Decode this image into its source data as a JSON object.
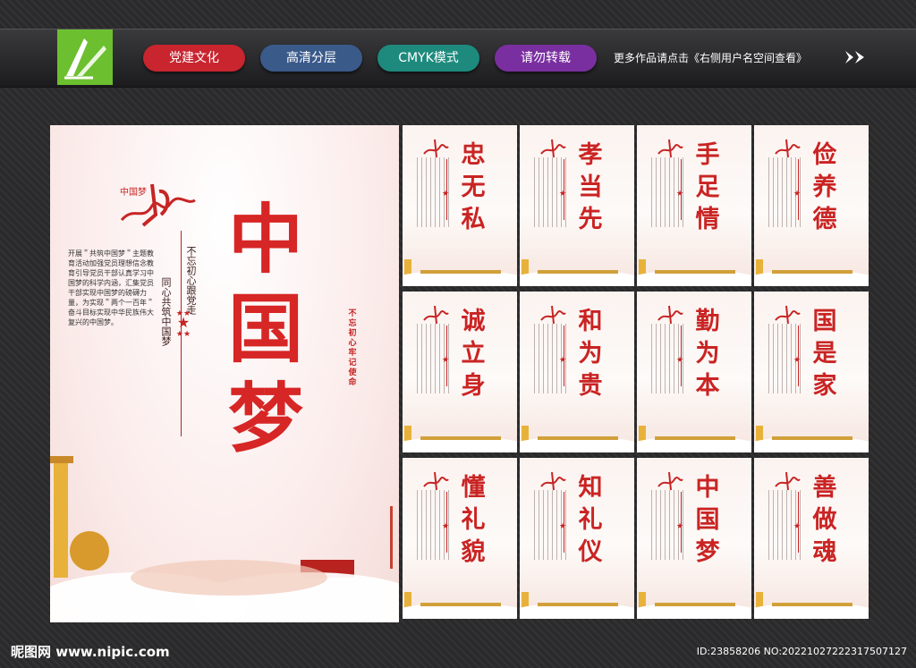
{
  "header": {
    "pills": [
      {
        "label": "党建文化",
        "color": "#c8252f"
      },
      {
        "label": "高清分层",
        "color": "#3a5a8a"
      },
      {
        "label": "CMYK模式",
        "color": "#1e8a7e"
      },
      {
        "label": "请勿转载",
        "color": "#7a2fa0"
      }
    ],
    "tagline": "更多作品请点击《右侧用户名空间查看》"
  },
  "main_poster": {
    "title": "中国梦",
    "slogan_line1": "不忘初心跟党走",
    "slogan_line2": "同心共筑中国梦",
    "body": "开展＂共筑中国梦＂主题教育活动加强党员理想信念教育引导党员干部认真学习中国梦的科学内涵，汇集党员干部实现中国梦的磅礴力量，为实现＂两个一百年＂奋斗目标实现中华民族伟大复兴的中国梦。",
    "seal": "不忘初心 牢记使命"
  },
  "posters": [
    {
      "title": "忠无私"
    },
    {
      "title": "孝当先"
    },
    {
      "title": "手足情"
    },
    {
      "title": "俭养德"
    },
    {
      "title": "诚立身"
    },
    {
      "title": "和为贵"
    },
    {
      "title": "勤为本"
    },
    {
      "title": "国是家"
    },
    {
      "title": "懂礼貌"
    },
    {
      "title": "知礼仪"
    },
    {
      "title": "中国梦"
    },
    {
      "title": "善做魂"
    }
  ],
  "footer": {
    "watermark": "昵图网 www.nipic.com",
    "id_text": "ID:23858206 NO:20221027222317507127"
  },
  "colors": {
    "accent_red": "#c92423",
    "logo_green": "#6cbf2e"
  }
}
